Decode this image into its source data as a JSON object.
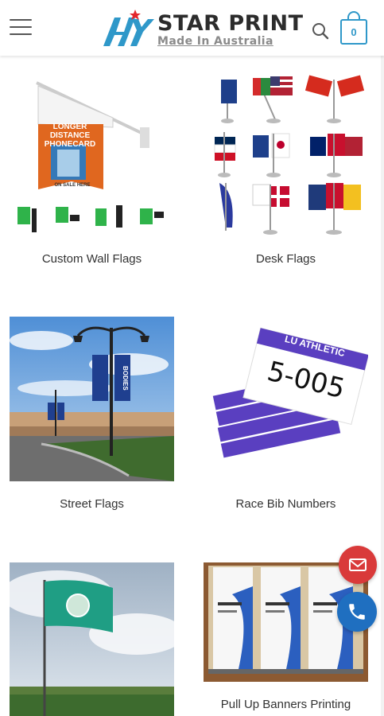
{
  "header": {
    "logo": {
      "title": "STAR PRINT",
      "subtitle": "Made In Australia"
    },
    "menu_icon": "hamburger-menu-icon",
    "search_icon": "search-icon",
    "cart": {
      "count": "0",
      "icon": "shopping-bag-icon"
    },
    "accent_color": "#2f98c9"
  },
  "categories": [
    {
      "label": "Custom Wall Flags",
      "banner_lines": [
        "LONGER",
        "DISTANCE",
        "PHONECARD"
      ],
      "banner_footer": "ON SALE HERE"
    },
    {
      "label": "Desk Flags"
    },
    {
      "label": "Street Flags",
      "banner_text": "BODIES"
    },
    {
      "label": "Race Bib Numbers",
      "bib_header": "LU ATHLETIC",
      "bib_number": "5-005"
    },
    {
      "label": ""
    },
    {
      "label": "Pull Up Banners Printing"
    }
  ],
  "floating_actions": {
    "email": {
      "icon": "envelope-icon",
      "color": "#d93a3a"
    },
    "phone": {
      "icon": "phone-icon",
      "color": "#1f6fc0"
    }
  }
}
